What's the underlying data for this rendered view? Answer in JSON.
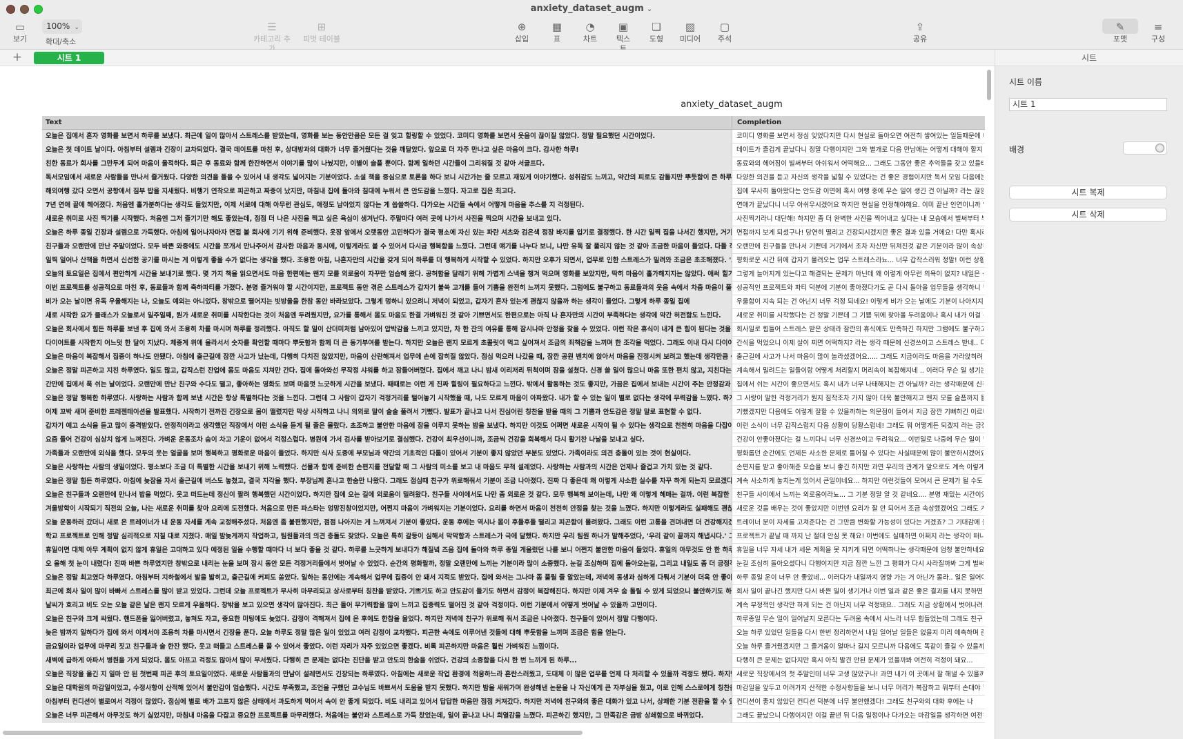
{
  "app": {
    "doc_title": "anxiety_dataset_augm",
    "title_chevron": "⌄"
  },
  "toolbar": {
    "view_label": "보기",
    "zoom_value": "100%",
    "zoom_label": "확대/축소",
    "add_category_label": "카테고리 추가",
    "pivot_label": "피벗 테이블",
    "insert_label": "삽입",
    "table_label": "표",
    "chart_label": "차트",
    "text_label": "텍스트",
    "shape_label": "도형",
    "media_label": "미디어",
    "comment_label": "주석",
    "share_label": "공유",
    "format_label": "포맷",
    "organize_label": "구성"
  },
  "tabs": {
    "add": "+",
    "sheet1": "시트 1",
    "inspector_tab": "시트"
  },
  "sheet": {
    "table_title": "anxiety_dataset_augm",
    "col_text": "Text",
    "col_completion": "Completion",
    "rows": [
      {
        "text": "오늘은 집에서 혼자 영화를 보면서 하루를 보냈다. 최근에 일이 많아서 스트레스를 받았는데, 영화를 보는 동안만큼은 모든 걸 잊고 힐링할 수 있었다. 코미디 영화를 보면서 웃음이 끊이질 않았다. 정말 필요했던 시간이었다.",
        "completion": "코미디 영화를 보면서 정심 잊었다지만 다시 현실로 돌아오면 여전히 쌓여있는 일들때문에 내"
      },
      {
        "text": "오늘은 첫 데이트 날이다. 아침부터 설렘과 긴장이 교차되었다. 결국 데이트를 마친 후, 상대방과의 대화가 너무 즐거웠다는 것을 깨달았다. 앞으로 더 자주 만나고 싶은 마음이 크다. 감사한 하루!",
        "completion": "데이트가 즐겁게 끝났다니 정말 다행이지만 그와 별개로 다음 만남에는 어떻게 대해야 할지 불"
      },
      {
        "text": "친한 동료가 회사를 그만두게 되어 마음이 울적하다. 퇴근 후 동료와 함께 한잔하면서 이야기를 많이 나눴지만, 이별이 슬플 뿐이다. 함께 일하던 시간들이 그리워질 것 같아 서글프다.",
        "completion": "동료와의 헤어짐이 빌써부터 아쉬워서 어떡해요... 그래도 그동안 좋은 추억들을 갖고 있을테니"
      },
      {
        "text": "독서모임에서 새로운 사람들을 만나서 즐거웠다. 다양한 의견을 들을 수 있어서 내 생각도 넓어지는 기분이었다. 소설 책을 중심으로 토론을 하다 보니 시간가는 줄 모르고 재밌게 이야기했다. 성취감도 느끼고, 약간의 피로도 감돌지만 뿌듯함이 큰 하루였다.",
        "completion": "다양한 의견을 듣고 자신의 생각을 넓힐 수 있었다는 건 좋은 경험이지만 독서 모임 다음에는 스"
      },
      {
        "text": "해외여행 갔다 오면서 공항에서 짐부 밥을 지새웠다. 비행기 연착으로 피곤하고 짜증이 났지만, 마침내 집에 돌아와 침대에 누워서 큰 안도감을 느꼈다. 자고로 집은 최고다.",
        "completion": "집에 무사히 돌아왔다는 안도감 이면에 혹시 여행 중에 무슨 일이 생긴 건 아닐까? 라는 끊임없"
      },
      {
        "text": "7년 연애 끝에 헤어졌다. 처음엔 홀가분하다는 생각도 들었지만, 이제 서로에 대해 아무런 관심도, 애정도 남아있지 않다는 게 씁쓸하다. 다가오는 시간들 속에서 어떻게 마음을 추스를 지 걱정된다.",
        "completion": "연애가 끝났다니 너무 아쉬우시겠어요 하지만 현실을 인정해야해요. 이미 끝난 인연이니까 일"
      },
      {
        "text": "새로운 취미로 사진 찍기를 시작했다. 처음엔 그저 즐기기만 해도 좋았는데, 점점 더 나은 사진을 찍고 싶은 욕심이 생겨난다. 주말마다 여러 곳에 나가서 사진을 찍으며 시간을 보내고 있다.",
        "completion": "사진찍기라니 대단해! 하지만 좀 더 완벽한 사진을 찍어내고 싶다는 내 모습에서 벌써부터 부담"
      },
      {
        "text": "오늘은 하루 종일 긴장과 설렘으로 가득했다. 아침에 일어나자마자 면접 볼 회사에 기기 위해 준비했다. 옷장 앞에서 오랫동안 고민하다가 결국 평소에 자신 있는 파란 셔츠와 검은색 정장 바지를 입기로 결정했다. 한 시간 일찍 집을 나서긴 했지만, 거기에 갈 때",
        "completion": "면접까지 보게 되셨구나! 당연히 떨리고 긴장되시겠지만 좋은 결과 있을 거에요! 다만 혹시라도"
      },
      {
        "text": "친구들과 오랜만에 만난 주말이었다. 모두 바쁜 와중에도 시간을 쪼개서 만나주어서 감사한 마음과 동시에, 이렇게라도 볼 수 있어서 다시금 행복함을 느꼈다. 그런데 얘기를 나누다 보니, 나만 유독 잘 풀리지 않는 것 같아 조금한 마음이 들었다. 다들 직장이나",
        "completion": "오랜만에 친구들을 만나서 기쁜데 거기에서 조차 자신만 뒤쳐진것 같은 기분이라 많이 속상하"
      },
      {
        "text": "일찍 일어나 산책을 하면서 신선한 공기를 마시는 게 이렇게 좋을 수가 없다는 생각을 했다. 조용한 아침, 나혼자만의 시간을 갖게 되어 하루를 더 행복하게 시작할 수 있었다. 하지만 오후가 되면서, 업무로 인한 스트레스가 밀려와 조금은 초조해졌다. '오늘은",
        "completion": "평화로운 시간 뒤에 갑자기 몰려오는 업무 스트레스라뇨... 너무 갑작스러워 정말! 이런 상황에"
      },
      {
        "text": "오늘의 토요일은 집에서 편안하게 시간을 보내기로 했다. 몇 가지 책을 읽으면서도 마음 한편에는 왠지 모를 외로움이 자꾸만 엄습해 왔다. 공허함을 달래기 위해 가볍게 스낵을 챙겨 먹으며 영화를 보았지만, 딱히 마음이 홀가해지지는 않았다. 애써 힐기를 불어",
        "completion": "그렇게 늘어지게 있는다고 해결되는 문제가 아닌데 왜 이렇게 아무런 의욕이 없지? 내일은 신"
      },
      {
        "text": "이번 프로젝트를 성공적으로 마친 후, 동료들과 함께 축하파티를 가졌다. 분명 즐거워야 할 시간이지만, 프로젝트 동안 겪은 스트레스가 갑자기 불쑥 고개를 들어 기쁨을 완전히 느끼지 못했다. 그럼에도 불구하고 동료들과의 웃음 속에서 차츰 마음이 풀어지는",
        "completion": "성공적인 프로젝트와 파티 덕분에 기분이 좋아졌다가도 곧 다시 돌아올 업무들을 생각하니 한"
      },
      {
        "text": "비가 오는 날이면 유독 우울해지는 나, 오늘도 예외는 아니었다. 창밖으로 떨어지는 빗방울을 한참 동안 바라보았다. 그렇게 멍하니 있으려니 저녁이 되었고, 갑자기 혼자 있는게 괜찮지 않을까 하는 생각이 들었다. 그렇게 하루 종일 집에",
        "completion": "우울함이 지속 되는 건 아닌지 너무 걱정 되네요! 이렇게 비가 오는 날에도 기분이 나아지지 않을"
      },
      {
        "text": "새로 시작한 요가 클래스가 오늘로서 일주일째, 뭔가 새로운 취미를 시작한다는 것이 처음엔 두려웠지만, 요가를 통해서 몸도 마음도 한결 가벼워진 것 같아 기쁘면서도 한편으로는 아직 나 혼자만의 시간이 부족하다는 생각에 약간 허전함도 느낀다.",
        "completion": "새로운 취미를 시작했다는 건 정말 기쁜데 그 기쁨 뒤에 찾아올 두려움이나 혹시 내가 이걸 꾸준"
      },
      {
        "text": "오늘은 회사에서 힘든 하루를 보낸 후 집에 와서 조용히 차를 마시며 하루를 정리했다. 아직도 할 일이 산더미처럼 남아있어 압박감을 느끼고 있지만, 차 한 잔의 여유를 통해 잠시나마 안정을 찾을 수 있었다. 이런 작은 휴식이 내게 큰 힘이 된다는 것을 다시금 새",
        "completion": "회사일로 힘들어 스트레스 받은 상태라 잠깐의 휴식에도 만족하긴 하지만 그럼에도 불구하고"
      },
      {
        "text": "다이어트를 시작한지 어느덧 한 달이 지났다. 체중계 위에 올라서서 숫자를 확인할 때마다 뿌듯함과 함께 더 큰 동기부여를 받는다. 하지만 오늘은 왠지 모르게 초콜릿이 먹고 싶어져서 조금의 죄책감을 느끼며 한 조각을 먹었다. 그래도 이내 다시 다이어트",
        "completion": "간식을 먹었으니 이제 살이 찌면 어떡하지? 라는 생각 때문에 신경쓰이고 스트레스 받네.. 다이"
      },
      {
        "text": "오늘은 마음이 복잡해서 집중이 하나도 안됐다. 아침에 출근길에 잠깐 사고가 났는데, 다행히 다치진 않았지만, 마음이 산란해져서 업무에 손에 잡히질 않았다. 점심 먹으러 나갔을 때, 잠깐 공원 벤치에 앉아서 마음을 진정시켜 보려고 했는데 생각만큼 쉬이 가",
        "completion": "출근길에 사고가 나서 마음이 많이 놀라셨겠어요..... 그래도 지금이라도 마음을 가라앉히려 노"
      },
      {
        "text": "오늘은 정말 피곤하고 지친 하루였다. 일도 많고, 갑작스런 잔업에 몸도 마음도 지쳐만 간다. 집에 돌아와선 무작정 샤워를 하고 잠들어버렸다. 집에서 깨고 나니 밤새 이리저리 뒤척이며 잠을 설쳤다. 신경 쓸 일이 많으니 마음 또한 편치 않고, 지친다는 생각이 자",
        "completion": "계속해서 밀려드는 일들이랑 어떻게 처리할지 머리속이 복잡해지네 .. 이러다 무슨 일 생기는"
      },
      {
        "text": "간만에 집에서 푹 쉬는 날이었다. 오랜만에 만난 친구와 수다도 떨고, 좋아하는 영화도 보며 마음껏 느긋하게 시간을 보냈다. 때때로는 이런 게 진짜 힐링이 필요하다고 느낀다. 밖에서 활동하는 것도 좋지만, 가끔은 집에서 보내는 시간이 주는 안정감과 편안함",
        "completion": "집에서 쉬는 시간이 좋으면서도 혹시 내가 너무 나태해지는 건 아닐까? 라는 생각때문에 신경"
      },
      {
        "text": "오늘은 정말 행복한 하루였다. 사랑하는 사람과 함께 보낸 시간은 항상 특별하다는 것을 느낀다. 그런데 그 사람이 갑자기 걱정거리를 털어놓기 시작했을 때, 나도 모르게 마음이 아파왔다. 내가 할 수 있는 일이 별로 없다는 생각에 무력감을 느꼈다. 하지만 솔직",
        "completion": "그 사랑이 말한 걱정거리가 뭔지 짐작조차 가지 않아 더욱 불안해지고 왠지 모를 슬픔까지 몰려"
      },
      {
        "text": "어제 꼬박 새며 준비한 프레젠테이션을 발표했다. 시작하기 전까진 긴장으로 몸이 떨렸지만 막상 시작하고 나니 의외로 말이 술술 풀려서 기뻤다. 발표가 끝나고 나서 진심어린 칭찬을 받을 때의 그 기쁨과 안도감은 정말 말로 표현할 수 없다.",
        "completion": "기뻤겠지만 다음에도 이렇게 잘할 수 있을까하는 의문점이 들어서 지금 잠깐 기뻐하긴 이르다"
      },
      {
        "text": "갑자기 예고 소식을 듣고 많이 충격받았다. 안정적이라고 생각했던 직장에서 이런 소식을 듣게 될 줄은 몰랐다. 초조하고 불안한 마음에 잠을 이루지 못하는 밤을 보냈다. 하지만 이것도 어쩌면 새로운 시작이 될 수 있다는 생각으로 천천히 마음을 다잡아가는 중",
        "completion": "이런 소식이 너무 갑작스럽지 다음 상황이 당황스럽네! 그래도 뭐 어떻게든 되겠지 라는 긍정적"
      },
      {
        "text": "요즘 들어 건강이 심상치 않게 느껴진다. 가벼운 운동조차 숨이 차고 기운이 없어서 걱정스럽다. 병원에 가서 검사를 받아보기로 결심했다. 건강이 최우선이니까, 조금씩 건강을 회복해서 다시 활기찬 나날을 보내고 싶다.",
        "completion": "건강이 안좋아졌다는 걸 느끼다니 너무 신경쓰이고 두려워요... 이번일로 나중에 무슨 일이 발"
      },
      {
        "text": "가족들과 오랜만에 외식을 했다. 모두의 웃는 얼굴을 보며 행복하고 평화로운 마음이 들었다. 하지만 식사 도중에 부모님과 약간의 기초적인 다툼이 있어서 기분이 좋지 않았던 부분도 있었다. 가족이라도 의견 충돌이 있는 것이 현실이다.",
        "completion": "평화롭던 순간에도 언제든 사소한 문제로 틀어질 수 있다는 사실때문에 많이 불안하시겠어요.."
      },
      {
        "text": "오늘은 사랑하는 사람의 생일이었다. 평소보다 조금 더 특별한 시간을 보내기 위해 노력했다. 선물과 함께 준비한 손편지를 전달할 때 그 사람의 미소를 보고 내 마음도 무척 설레었다. 사랑하는 사람과의 시간은 언제나 즐겁고 가치 있는 것 같다.",
        "completion": "손편지를 받고 좋아해준 모습을 보니 좋긴 하지만 과연 우리의 관계가 앞으로도 계속 이렇게 이"
      },
      {
        "text": "오늘은 정말 힘든 하루였다. 아침에 늦잠을 자서 출근길에 버스도 놓쳤고, 결국 지각을 했다. 부장님께 혼나고 한숨만 나왔다. 그래도 점심때 친구가 위로해줘서 기분이 조금 나아졌다. 진짜 다 좋은데 왜 이렇게 사소한 실수를 자꾸 하게 되는지 모르겠다. 저녁엔",
        "completion": "계속 사소하게 놓치는게 있어서 큰일이네요... 하지만 이런것들이 모여서 큰 문제가 될 수도 있"
      },
      {
        "text": "오늘은 친구들과 오랜만에 만나서 밥을 먹었다. 웃고 떠드는데 정신이 팔려 행복했던 시간이었다. 하지만 집에 오는 길에 외로움이 밀려왔다. 친구들 사이에서도 나만 좀 외로운 것 같다. 모두 행복해 보이는데, 나만 왜 이렇게 헤매는 걸까. 이런 복잡한 감정들, 가",
        "completion": "친구들 사이에서 느끼는 외로움이라뇨... 그 기분 정말 알 것 같네요.... 분명 재밌는 시간이었지"
      },
      {
        "text": "겨울방학이 시작되기 직전의 오늘, 나는 새로운 취미를 찾아 요리에 도전했다. 처음으로 만든 파스타는 엉망진창이었지만, 어쩐지 마음이 가벼워지는 기분이었다. 요리를 하면서 마음이 천천히 안정을 찾는 것을 느꼈다. 하지만 이렇게라도 실패해도 괜찮다는 것을",
        "completion": "새로운 것을 배우는 것이 좋았지만 이번엔 요리가 잘 안 되어서 조금 속상했겠어요 그래도 계속"
      },
      {
        "text": "오늘 운동하러 갔더니 새로 온 트레이너가 내 운동 자세를 계속 교정해주셨다. 처음엔 좀 불편했지만, 점점 나아지는 게 느껴져서 기분이 좋았다. 운동 후에는 역시나 몸이 후들후들 떨리고 피곤함이 몰려왔다. 그래도 이런 고통을 견뎌내면 더 건강해지겠지 라는",
        "completion": "트레이너 분이 자세를 고쳐준다는 건 그만큼 변화할 가능성이 있다는 거겠죠? 그 기대감에 들"
      },
      {
        "text": "학교 프로젝트로 인해 정말 심리적으로 지칠 대로 지쳤다. 매일 밤늦게까지 작업하고, 팀원들과의 의견 충돌도 잦았다. 오늘은 특히 갈등이 심해서 막막함과 스트레스가 극에 달했다. 하지만 우리 팀원 하나가 말해주었다, '우리 같이 끝까지 해냅시다.' 그 말이 큰",
        "completion": "프로젝트가 끝날 때 까지 난 절대 안심 못 해요! 이번에도 실패하면 어쩌지 라는 생각이 떠나지"
      },
      {
        "text": "휴일이면 대체 아무 계획이 없지 않게 휴일은 고대하고 있다 예정된 일을 수행할 때마다 너 보다 좋을 것 같다. 하루를 느긋하게 보내다가 해질녘 즈음 집에 돌아와 하루 종일 게을렀던 나를 보니 어쩐지 불안한 마음이 들었다. 휴일의 아무것도 안 한 하루 보낸 것",
        "completion": "휴일을 너무 자세 내가 세운 계획을 못 지키게 되면 어떡하나는 생각때문에 엄청 불안하네요.."
      },
      {
        "text": "오 올해 첫 눈이 내렸다! 진짜 바쁜 하루였지만 창밖으로 내리는 눈을 보며 잠시 동안 모든 걱정거리들에서 벗어날 수 있었다. 순간의 평화랄까, 정말 오랜만에 느끼는 기분이라 많이 소중했다. 눈길 조심하며 집에 돌아오는길, 그리고 내일도 좀 더 긍정적으로 시",
        "completion": "눈길 조심히 돌아오셨다니 다행이지만 지금 잠깐 느낀 그 평화가 다시 사라질까봐 그게 벌써부"
      },
      {
        "text": "오늘은 정말 최고였다 하루였다. 아침부터 지하철에서 발을 밟히고, 출근길에 커피도 쏟았다. 일하는 동안에는 계속해서 업무에 집중이 안 돼서 지적도 받았다. 집에 와서는 그나마 좀 풀릴 줄 알았는데, 저녁에 동생과 심하게 다퉈서 기분이 더욱 안 좋아졌다. 이",
        "completion": "하루 종일 운이 너무 안 좋았네... 이러다가 내일까지 영향 가는 거 아닌가 몰라.. 일은 일어야 하"
      },
      {
        "text": "최근에 회사 일이 많이 바빠서 스트레스를 많이 받고 있었다. 그런데 오늘 프로젝트가 무사히 마무리되고 상사로부터 칭찬을 받았다. 기쁘기도 하고 안도감이 들기도 하면서 감정이 복잡해진다. 하지만 이제 겨우 숨 돌릴 수 있게 되었으니 불안하기도 하다. 이제는 좀 쉬 수 있을",
        "completion": "회사 일이 끝나긴 했지만 다시 바쁜 일이 생기거나 이번 일과 같은 좋은 결과를 내지 못하면 어"
      },
      {
        "text": "날씨가 흐리고 비도 오는 오늘 같은 날은 왠지 모르게 우울하다. 창밖을 보고 있으면 생각이 많아진다. 최근 들어 무기력함을 많이 느끼고 집중력도 떨어진 것 같아 걱정이다. 이런 기분에서 어떻게 벗어날 수 있을까 고민이다.",
        "completion": "계속 부정적인 생각만 하게 되는 건 아닌지 너무 걱정돼요.. 그래도 지금 상황에서 벗어나려고"
      },
      {
        "text": "오늘은 친구와 크게 싸웠다. 핸드폰을 잃어버렸고, 놓쳐도 자고, 중요한 미팅에도 늦었다. 감정이 격해져서 집에 온 후에도 한참을 울었다. 하지만 저녁에 친구가 위로해 줘서 조금은 나아졌다. 친구들이 있어서 정말 다행이다.",
        "completion": "하루종일 무슨 일이 일어날지 모른다는 두려움 속에서 사느라 너무 힘들었는데 그래도 친구 덕"
      },
      {
        "text": "늦은 밤까지 일하다가 집에 와서 이제서야 조용히 차를 마시면서 긴장을 푼다. 오늘 하루도 정말 많은 일이 있었고 여러 감정이 교차했다. 피곤한 속에도 이루어낸 것들에 대해 뿌듯함을 느끼며 조금은 힘을 얻는다.",
        "completion": "오늘 하루 있었던 일들을 다시 한번 정리하면서 내일 일어날 일들은 없을지 미리 예측하며 준비"
      },
      {
        "text": "금요일이라 업무에 마무리 짓고 친구들과 술 한잔 했다. 웃고 떠들고 스트레스를 풀 수 있어서 좋았다. 이런 자리가 자주 있었으면 좋겠다. 비록 피곤하지만 마음은 훨씬 가벼워진 느낌이다.",
        "completion": "오늘 하루 즐거웠겠지만 그 즐거움이 얼마나 길지 모르니까 다음에도 똑같이 즐길 수 있을까봐"
      },
      {
        "text": "새벽에 급하게 아파서 병원을 가게 되었다. 몸도 아프고 걱정도 많아서 많이 무서웠다. 다행히 큰 문제는 없다는 진단을 받고 안도의 한숨을 쉬었다. 건강의 소중함을 다시 한 번 느끼게 된 하루...",
        "completion": "다행히 큰 문제는 없다지만 혹시 아직 발견 안된 문제가 있을까봐 여전히 걱정이 돼요..."
      },
      {
        "text": "오늘은 직장을 옮긴 지 일마 안 된 첫번째 피곤 후의 토요일이었다. 새로운 사람들과의 만남이 설레면서도 긴장되는 하루였다. 아침에는 새로운 작업 환경에 적응하느라 혼란스러웠고, 도대체 이 많은 업무를 언제 다 처리할 수 있을까 걱정도 됐다. 하지만 오후에",
        "completion": "새로운 직장에서의 첫 주말인데 너무 고생 많았구나! 과연 내가 이 곳에서 잘 해낼 수 있을까?"
      },
      {
        "text": "오늘은 대학원의 마감일이었고, 수정사항이 산적해 있어서 불안감이 엄습했다. 시간도 부족했고, 조언을 구했던 교수님도 바쁘셔서 도움을 받지 못했다. 하지만 밤을 새워가며 완성해낸 논문을 나 자신에게 큰 자부심을 줬고, 이로 인해 스스로에게 칭찬을 아끼지",
        "completion": "마감일을 앞두고 어려가지 산적한 수정사항들을 보니 너무 머리가 복잡하고 뭐부터 손대야 할"
      },
      {
        "text": "아침부터 컨디션이 별로여서 걱정이 많았다. 점심에 별로 배가 고프지 않은 상태에서 과도하게 먹어서 속이 안 좋게 되었다. 비도 내리고 있어서 답답한 마음만 점점 커져갔다. 하지만 저녁에 친구와의 좋은 대화가 있고 나서, 상쾌한 기분 전환을 할 수 있었다.",
        "completion": "컨디션이 좋지 않았던 컨디션 덕분에 너무 불안했겠다! 그래도 친구와의 대화 후에는 나"
      },
      {
        "text": "오늘은 너무 피곤해서 아무것도 하기 싫었지만, 마침내 마음을 다잡고 중요한 프로젝트를 마무리했다. 처음에는 불안과 스트레스로 가득 찼었는데, 일이 끝나고 나니 희열감을 느꼈다. 피곤하긴 했지만, 그 만족감은 금방 상쇄함으로 바뀌었다.",
        "completion": "그래도 끝났으니 다행이지만 이걸 끝낸 뒤 다음 일정이나 다가오는 마감일을 생각하면 여전히"
      }
    ]
  },
  "inspector": {
    "sheet_name_label": "시트 이름",
    "sheet_name_value": "시트 1",
    "background_label": "배경",
    "duplicate_button": "시트 복제",
    "delete_button": "시트 삭제"
  }
}
